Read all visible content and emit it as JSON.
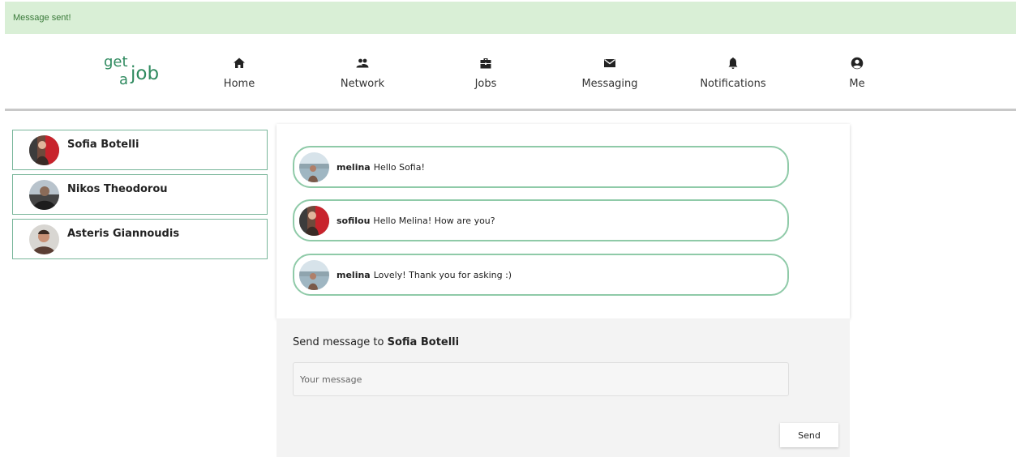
{
  "alert": {
    "text": "Message sent!"
  },
  "logo": {
    "part1": "get",
    "part2": "a",
    "part3": "job"
  },
  "nav": {
    "items": [
      {
        "label": "Home",
        "icon": "home-icon"
      },
      {
        "label": "Network",
        "icon": "people-icon"
      },
      {
        "label": "Jobs",
        "icon": "briefcase-icon"
      },
      {
        "label": "Messaging",
        "icon": "envelope-icon"
      },
      {
        "label": "Notifications",
        "icon": "bell-icon"
      },
      {
        "label": "Me",
        "icon": "user-circle-icon"
      }
    ]
  },
  "contacts": [
    {
      "name": "Sofia Botelli"
    },
    {
      "name": "Nikos Theodorou"
    },
    {
      "name": "Asteris Giannoudis"
    }
  ],
  "messages": [
    {
      "sender": "melina",
      "text": "Hello Sofia!"
    },
    {
      "sender": "sofilou",
      "text": "Hello Melina! How are you?"
    },
    {
      "sender": "melina",
      "text": "Lovely! Thank you for asking :)"
    }
  ],
  "composer": {
    "heading_prefix": "Send message to",
    "recipient": "Sofia Botelli",
    "placeholder": "Your message",
    "value": "",
    "send_label": "Send"
  },
  "colors": {
    "brand": "#2f8a5f",
    "alert_bg": "#d9efd6",
    "alert_text": "#3a7a3a",
    "bubble_border": "#8fcaa8",
    "contact_border": "#79b69a"
  }
}
